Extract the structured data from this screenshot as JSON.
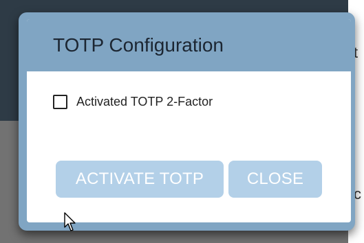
{
  "background": {
    "fragment_top": "t",
    "fragment_bottom": "c"
  },
  "dialog": {
    "title": "TOTP Configuration",
    "checkbox": {
      "label": "Activated TOTP 2-Factor",
      "checked": false
    },
    "buttons": {
      "activate_label": "ACTIVATE TOTP",
      "close_label": "CLOSE"
    }
  },
  "colors": {
    "header": "#80a5c3",
    "button": "#b3d0e8",
    "overlay_top": "#2e3b46",
    "overlay_bottom": "#727272"
  },
  "icons": {
    "cursor": "mouse-pointer-icon"
  }
}
